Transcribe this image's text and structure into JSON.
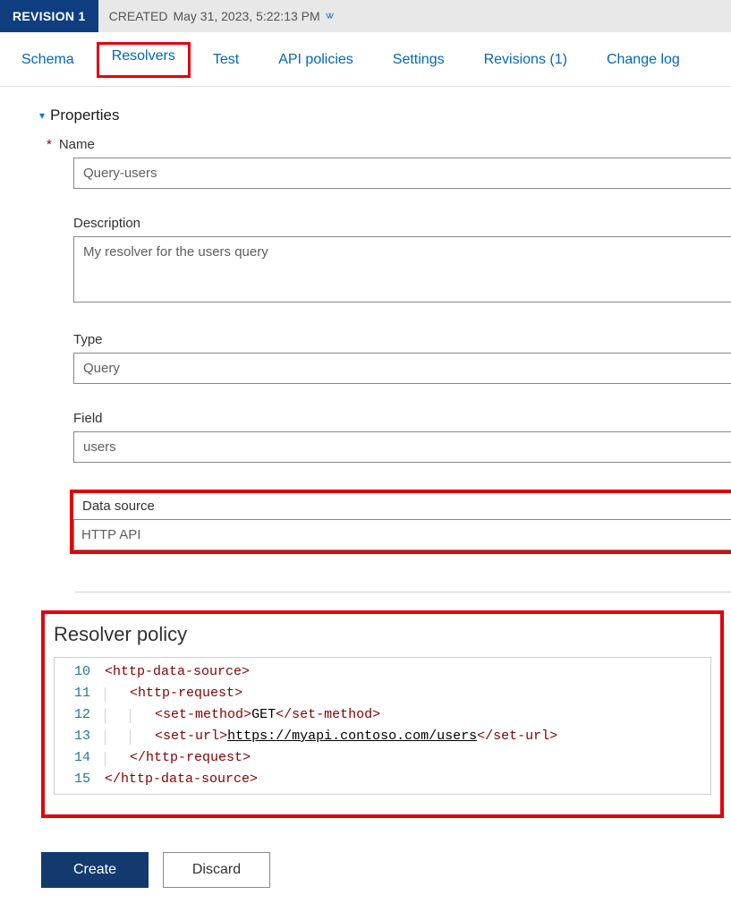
{
  "revision": {
    "badge": "REVISION 1",
    "created_prefix": "CREATED",
    "created_value": "May 31, 2023, 5:22:13 PM"
  },
  "tabs": {
    "schema": "Schema",
    "resolvers": "Resolvers",
    "test": "Test",
    "api_policies": "API policies",
    "settings": "Settings",
    "revisions": "Revisions (1)",
    "change_log": "Change log"
  },
  "section": {
    "properties": "Properties"
  },
  "form": {
    "name_label": "Name",
    "name_value": "Query-users",
    "description_label": "Description",
    "description_value": "My resolver for the users query",
    "type_label": "Type",
    "type_value": "Query",
    "field_label": "Field",
    "field_value": "users",
    "data_source_label": "Data source",
    "data_source_value": "HTTP API"
  },
  "policy": {
    "title": "Resolver policy",
    "lines": [
      {
        "n": "10",
        "indent": 0,
        "pre": "<",
        "tag": "http-data-source",
        "post": ">"
      },
      {
        "n": "11",
        "indent": 1,
        "pre": "<",
        "tag": "http-request",
        "post": ">"
      },
      {
        "n": "12",
        "indent": 2,
        "pre": "<",
        "tag": "set-method",
        "mid": ">GET</",
        "tag2": "set-method",
        "post2": ">"
      },
      {
        "n": "13",
        "indent": 2,
        "pre": "<",
        "tag": "set-url",
        "mid_open": ">",
        "url": "https://myapi.contoso.com/users",
        "mid_close": "</",
        "tag2": "set-url",
        "post2": ">"
      },
      {
        "n": "14",
        "indent": 1,
        "pre": "</",
        "tag": "http-request",
        "post": ">"
      },
      {
        "n": "15",
        "indent": 0,
        "pre": "</",
        "tag": "http-data-source",
        "post": ">"
      }
    ]
  },
  "actions": {
    "create": "Create",
    "discard": "Discard"
  }
}
